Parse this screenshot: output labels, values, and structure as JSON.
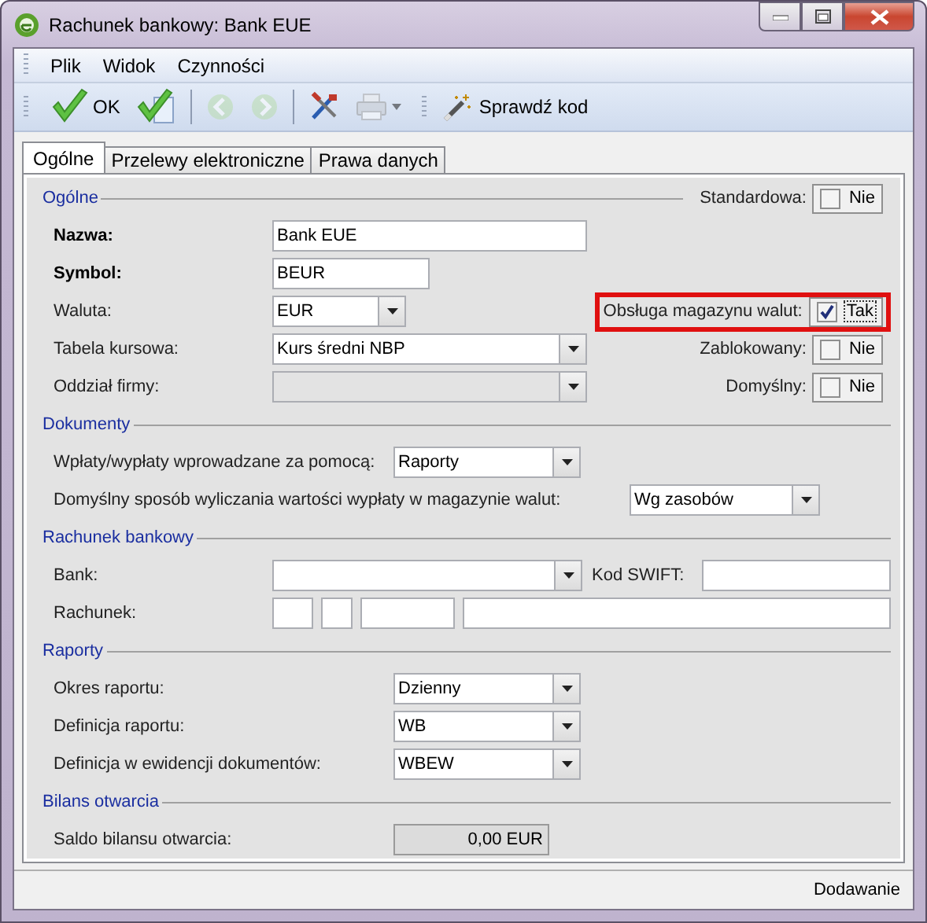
{
  "window": {
    "title": "Rachunek bankowy: Bank EUE"
  },
  "menu": [
    {
      "label": "Plik"
    },
    {
      "label": "Widok"
    },
    {
      "label": "Czynności"
    }
  ],
  "toolbar": [
    {
      "kind": "ok",
      "label": "OK",
      "disabled": false
    },
    {
      "kind": "save-new",
      "disabled": false
    },
    {
      "kind": "back",
      "disabled": true
    },
    {
      "kind": "forward",
      "disabled": true
    },
    {
      "kind": "tools",
      "disabled": false
    },
    {
      "kind": "print",
      "disabled": true
    },
    {
      "kind": "wand",
      "label": "Sprawdź kod",
      "disabled": false
    }
  ],
  "tabs": [
    {
      "label": "Ogólne",
      "selected": true
    },
    {
      "label": "Przelewy elektroniczne",
      "selected": false
    },
    {
      "label": "Prawa danych",
      "selected": false
    }
  ],
  "general": {
    "title": "Ogólne",
    "fields": [
      {
        "label": "Nazwa:",
        "kind": "text",
        "value": "Bank EUE",
        "bold": true,
        "disabled": false
      },
      {
        "label": "Symbol:",
        "kind": "text",
        "value": "BEUR",
        "bold": true,
        "disabled": false
      },
      {
        "label": "Waluta:",
        "kind": "combo",
        "value": "EUR",
        "bold": false,
        "disabled": false
      },
      {
        "label": "Tabela kursowa:",
        "kind": "combo",
        "value": "Kurs średni NBP",
        "bold": false,
        "disabled": false
      },
      {
        "label": "Oddział firmy:",
        "kind": "combo",
        "bold": false,
        "disabled": true
      }
    ],
    "flags": [
      {
        "label": "Standardowa:",
        "text": "Nie",
        "checked": false,
        "highlighted": false
      },
      {
        "label": "Obsługa magazynu walut:",
        "text": "Tak",
        "checked": true,
        "highlighted": true
      },
      {
        "label": "Zablokowany:",
        "text": "Nie",
        "checked": false,
        "highlighted": false
      },
      {
        "label": "Domyślny:",
        "text": "Nie",
        "checked": false,
        "highlighted": false
      }
    ]
  },
  "documents": {
    "title": "Dokumenty",
    "fields": [
      {
        "label": "Wpłaty/wypłaty wprowadzane za pomocą:",
        "kind": "combo",
        "value": "Raporty",
        "bold": false,
        "disabled": false
      },
      {
        "label": "Domyślny sposób wyliczania wartości wypłaty w magazynie walut:",
        "kind": "combo",
        "value": "Wg zasobów",
        "bold": false,
        "disabled": false
      }
    ]
  },
  "bank_account": {
    "title": "Rachunek bankowy",
    "fields": [
      {
        "label": "Bank:",
        "kind": "combo",
        "bold": false,
        "disabled": false
      },
      {
        "label": "Kod SWIFT:",
        "kind": "text",
        "bold": false,
        "disabled": false
      },
      {
        "label": "Rachunek:",
        "kind": "text",
        "bold": false,
        "disabled": false
      }
    ]
  },
  "reports": {
    "title": "Raporty",
    "fields": [
      {
        "label": "Okres raportu:",
        "kind": "combo",
        "value": "Dzienny",
        "bold": false,
        "disabled": false
      },
      {
        "label": "Definicja raportu:",
        "kind": "combo",
        "value": "WB",
        "bold": false,
        "disabled": false
      },
      {
        "label": "Definicja w ewidencji dokumentów:",
        "kind": "combo",
        "value": "WBEW",
        "bold": false,
        "disabled": false
      }
    ]
  },
  "opening_balance": {
    "title": "Bilans otwarcia",
    "fields": [
      {
        "label": "Saldo bilansu otwarcia:",
        "kind": "readonly",
        "value": "0,00 EUR",
        "bold": false,
        "disabled": true
      }
    ]
  },
  "status_bar": "Dodawanie"
}
